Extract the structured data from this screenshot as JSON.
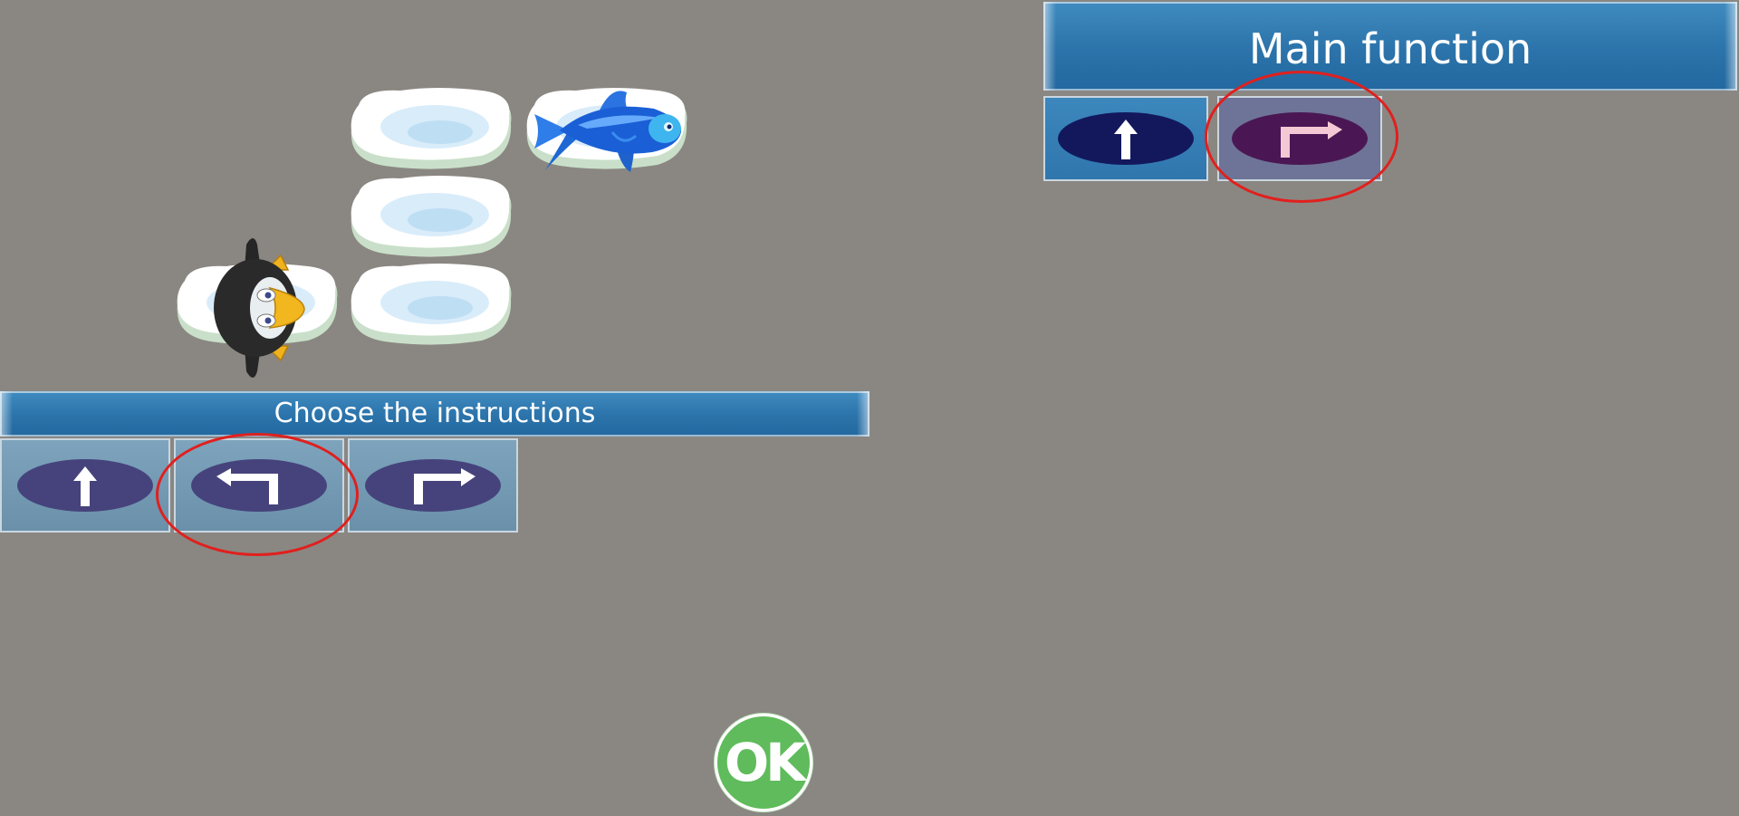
{
  "palette": {
    "title": "Choose the instructions",
    "items": [
      {
        "icon": "arrow-up-icon",
        "action": "forward"
      },
      {
        "icon": "turn-left-icon",
        "action": "turn-left"
      },
      {
        "icon": "turn-right-icon",
        "action": "turn-right"
      }
    ]
  },
  "program": {
    "title": "Main function",
    "items": [
      {
        "icon": "arrow-up-icon",
        "action": "forward"
      },
      {
        "icon": "turn-right-icon",
        "action": "turn-right"
      }
    ]
  },
  "ok_button": {
    "label": "OK"
  },
  "colors": {
    "background": "#8a8782",
    "banner": "#2b73aa",
    "highlight": "#e0201e",
    "ok": "#5fbb5b"
  }
}
